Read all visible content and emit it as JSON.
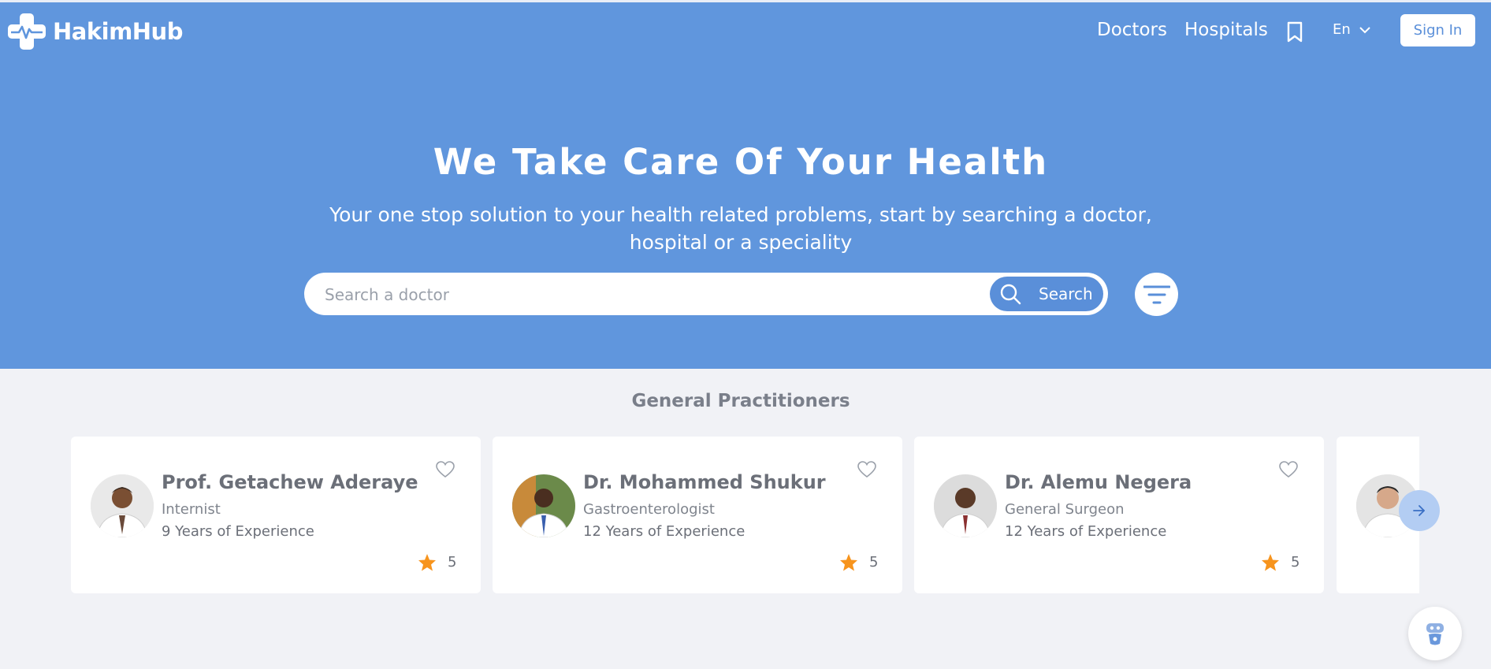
{
  "brand": {
    "name": "HakimHub"
  },
  "nav": {
    "doctors": "Doctors",
    "hospitals": "Hospitals",
    "language": "En",
    "sign_in": "Sign In"
  },
  "hero": {
    "title": "We Take Care Of Your Health",
    "subtitle": "Your one stop solution to your health related problems, start by searching a doctor, hospital or a speciality"
  },
  "search": {
    "placeholder": "Search a doctor",
    "button_label": "Search"
  },
  "section": {
    "title": "General Practitioners"
  },
  "doctors": [
    {
      "name": "Prof. Getachew Aderaye",
      "specialty": "Internist",
      "experience": "9 Years of Experience",
      "rating": "5"
    },
    {
      "name": "Dr. Mohammed Shukur",
      "specialty": "Gastroenterologist",
      "experience": "12 Years of Experience",
      "rating": "5"
    },
    {
      "name": "Dr. Alemu Negera",
      "specialty": "General Surgeon",
      "experience": "12 Years of Experience",
      "rating": "5"
    }
  ],
  "colors": {
    "hero_bg": "#6096dd",
    "accent": "#5a8fd9",
    "star": "#f7941d",
    "page_bg": "#f1f2f6"
  }
}
